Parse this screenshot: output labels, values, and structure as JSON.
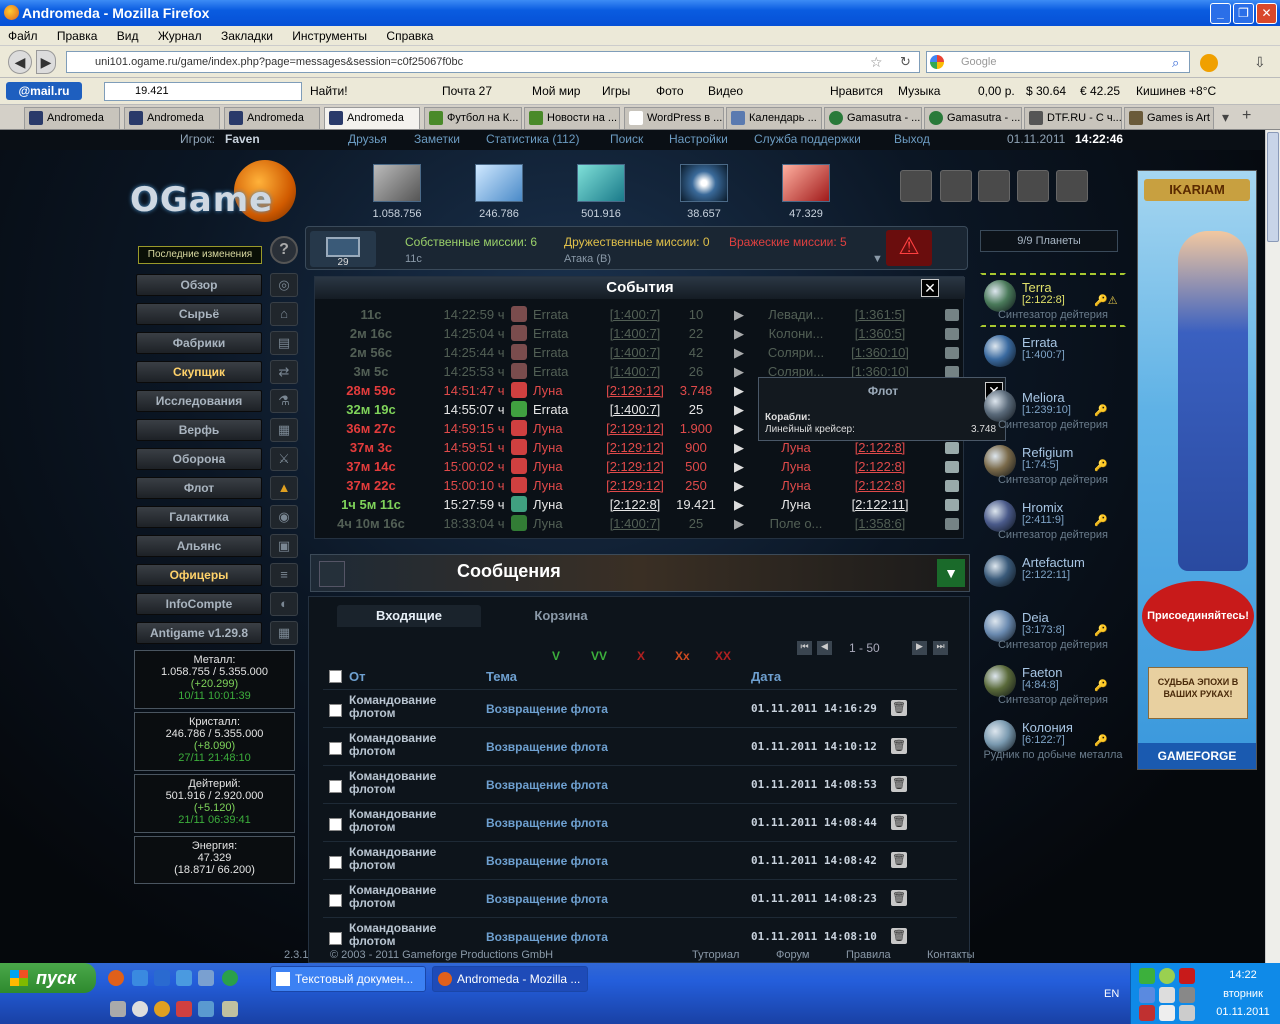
{
  "window": {
    "title": "Andromeda - Mozilla Firefox"
  },
  "menu": [
    "Файл",
    "Правка",
    "Вид",
    "Журнал",
    "Закладки",
    "Инструменты",
    "Справка"
  ],
  "nav": {
    "url": "uni101.ogame.ru/game/index.php?page=messages&session=c0f25067f0bc",
    "search_placeholder": "Google"
  },
  "mailru": {
    "logo": "@mail.ru",
    "search_value": "19.421",
    "find": "Найти!",
    "items": [
      "Почта 27",
      "Мой мир",
      "Игры",
      "Фото",
      "Видео",
      "Нравится",
      "Музыка",
      "0,00 р.",
      "$ 30.64",
      "€ 42.25",
      "Кишинев +8°C"
    ]
  },
  "tabs": [
    "Andromeda",
    "Andromeda",
    "Andromeda",
    "Andromeda",
    "Футбол на К...",
    "Новости на ...",
    "WordPress в ...",
    "Календарь ...",
    "Gamasutra - ...",
    "Gamasutra - ...",
    "DTF.RU - С ч...",
    "Games is Art ..."
  ],
  "game": {
    "topinfo": {
      "player_label": "Игрок:",
      "player": "Faven",
      "links": [
        "Друзья",
        "Заметки",
        "Статистика (112)",
        "Поиск",
        "Настройки",
        "Служба поддержки",
        "Выход"
      ],
      "datetime": "01.11.2011",
      "time": "14:22:46"
    },
    "logo": "OGame",
    "resources": [
      "1.058.756",
      "246.786",
      "501.916",
      "38.657",
      "47.329"
    ],
    "last_changes": "Последние изменения",
    "help_icon": "?",
    "menu": [
      {
        "label": "Обзор",
        "hl": false
      },
      {
        "label": "Сырьё",
        "hl": false
      },
      {
        "label": "Фабрики",
        "hl": false
      },
      {
        "label": "Скупщик",
        "hl": true
      },
      {
        "label": "Исследования",
        "hl": false
      },
      {
        "label": "Верфь",
        "hl": false
      },
      {
        "label": "Оборона",
        "hl": false
      },
      {
        "label": "Флот",
        "hl": false
      },
      {
        "label": "Галактика",
        "hl": false
      },
      {
        "label": "Альянс",
        "hl": false
      },
      {
        "label": "Офицеры",
        "hl": true
      },
      {
        "label": "InfoCompte",
        "hl": false
      },
      {
        "label": "Antigame v1.29.8",
        "hl": false
      }
    ],
    "resboxes": [
      {
        "name": "Металл:",
        "amount": "1.058.755 / 5.355.000",
        "prod": "(+20.299)",
        "date": "10/11 10:01:39"
      },
      {
        "name": "Кристалл:",
        "amount": "246.786 / 5.355.000",
        "prod": "(+8.090)",
        "date": "27/11 21:48:10"
      },
      {
        "name": "Дейтерий:",
        "amount": "501.916 / 2.920.000",
        "prod": "(+5.120)",
        "date": "21/11 06:39:41"
      },
      {
        "name": "Энергия:",
        "amount": "47.329",
        "prod": "(18.871/ 66.200)",
        "date": ""
      }
    ],
    "fleetbar": {
      "msg_count": "29",
      "own": "Собственные миссии: 6",
      "friendly": "Дружественные миссии: 0",
      "hostile": "Вражеские миссии: 5",
      "next_time": "11с",
      "next_mission": "Атака (В)"
    },
    "events": {
      "title": "События",
      "rows": [
        {
          "t": "11с",
          "at": "14:22:59 ч",
          "own": "Errata",
          "from": "[1:400:7]",
          "n": "10",
          "dest": "Левади...",
          "to": "[1:361:5]",
          "cls": "dim",
          "col": "#a06060"
        },
        {
          "t": "2м 16с",
          "at": "14:25:04 ч",
          "own": "Errata",
          "from": "[1:400:7]",
          "n": "22",
          "dest": "Колони...",
          "to": "[1:360:5]",
          "cls": "dim",
          "col": "#a06060"
        },
        {
          "t": "2м 56с",
          "at": "14:25:44 ч",
          "own": "Errata",
          "from": "[1:400:7]",
          "n": "42",
          "dest": "Соляри...",
          "to": "[1:360:10]",
          "cls": "dim",
          "col": "#a06060"
        },
        {
          "t": "3м 5с",
          "at": "14:25:53 ч",
          "own": "Errata",
          "from": "[1:400:7]",
          "n": "26",
          "dest": "Соляри...",
          "to": "[1:360:10]",
          "cls": "dim",
          "col": "#a06060"
        },
        {
          "t": "28м 59с",
          "at": "14:51:47 ч",
          "own": "Луна",
          "from": "[2:129:12]",
          "n": "3.748",
          "dest": "",
          "to": "",
          "cls": "red",
          "col": "#d04040"
        },
        {
          "t": "32м 19с",
          "at": "14:55:07 ч",
          "own": "Errata",
          "from": "[1:400:7]",
          "n": "25",
          "dest": "",
          "to": "",
          "cls": "green",
          "col": "#40a040"
        },
        {
          "t": "36м 27с",
          "at": "14:59:15 ч",
          "own": "Луна",
          "from": "[2:129:12]",
          "n": "1.900",
          "dest": "",
          "to": "",
          "cls": "red",
          "col": "#d04040"
        },
        {
          "t": "37м 3с",
          "at": "14:59:51 ч",
          "own": "Луна",
          "from": "[2:129:12]",
          "n": "900",
          "dest": "Луна",
          "to": "[2:122:8]",
          "cls": "red",
          "col": "#d04040"
        },
        {
          "t": "37м 14с",
          "at": "15:00:02 ч",
          "own": "Луна",
          "from": "[2:129:12]",
          "n": "500",
          "dest": "Луна",
          "to": "[2:122:8]",
          "cls": "red",
          "col": "#d04040"
        },
        {
          "t": "37м 22с",
          "at": "15:00:10 ч",
          "own": "Луна",
          "from": "[2:129:12]",
          "n": "250",
          "dest": "Луна",
          "to": "[2:122:8]",
          "cls": "red",
          "col": "#d04040"
        },
        {
          "t": "1ч 5м 11с",
          "at": "15:27:59 ч",
          "own": "Луна",
          "from": "[2:122:8]",
          "n": "19.421",
          "dest": "Луна",
          "to": "[2:122:11]",
          "cls": "green",
          "col": "#40a080"
        },
        {
          "t": "4ч 10м 16с",
          "at": "18:33:04 ч",
          "own": "Луна",
          "from": "[1:400:7]",
          "n": "25",
          "dest": "Поле о...",
          "to": "[1:358:6]",
          "cls": "dim",
          "col": "#40a040"
        }
      ]
    },
    "tooltip": {
      "title": "Флот",
      "ships_label": "Корабли:",
      "ship": "Линейный крейсер:",
      "count": "3.748"
    },
    "messages": {
      "title": "Сообщения",
      "tab_inbox": "Входящие",
      "tab_trash": "Корзина",
      "filters": [
        "V",
        "VV",
        "X",
        "Xx",
        "XX"
      ],
      "paging": "1 - 50",
      "cols": {
        "from": "От",
        "subject": "Тема",
        "date": "Дата"
      },
      "rows": [
        {
          "from": "Командование флотом",
          "subject": "Возвращение флота",
          "date": "01.11.2011 14:16:29"
        },
        {
          "from": "Командование флотом",
          "subject": "Возвращение флота",
          "date": "01.11.2011 14:10:12"
        },
        {
          "from": "Командование флотом",
          "subject": "Возвращение флота",
          "date": "01.11.2011 14:08:53"
        },
        {
          "from": "Командование флотом",
          "subject": "Возвращение флота",
          "date": "01.11.2011 14:08:44"
        },
        {
          "from": "Командование флотом",
          "subject": "Возвращение флота",
          "date": "01.11.2011 14:08:42"
        },
        {
          "from": "Командование флотом",
          "subject": "Возвращение флота",
          "date": "01.11.2011 14:08:23"
        },
        {
          "from": "Командование флотом",
          "subject": "Возвращение флота",
          "date": "01.11.2011 14:08:10"
        }
      ]
    },
    "planet_count": "9/9 Планеты",
    "planets": [
      {
        "name": "Terra",
        "coord": "[2:122:8]",
        "sub": "Синтезатор дейтерия",
        "key": "🔑⚠",
        "c": "#4a7a5a"
      },
      {
        "name": "Errata",
        "coord": "[1:400:7]",
        "sub": "",
        "key": "",
        "c": "#3a6aa0"
      },
      {
        "name": "Meliora",
        "coord": "[1:239:10]",
        "sub": "Синтезатор дейтерия",
        "key": "🔑",
        "c": "#5a6a7a"
      },
      {
        "name": "Refigium",
        "coord": "[1:74:5]",
        "sub": "Синтезатор дейтерия",
        "key": "🔑",
        "c": "#7a6a4a"
      },
      {
        "name": "Hromix",
        "coord": "[2:411:9]",
        "sub": "Синтезатор дейтерия",
        "key": "🔑",
        "c": "#4a5a8a"
      },
      {
        "name": "Artefactum",
        "coord": "[2:122:11]",
        "sub": "",
        "key": "",
        "c": "#3a5a7a"
      },
      {
        "name": "Deia",
        "coord": "[3:173:8]",
        "sub": "Синтезатор дейтерия",
        "key": "🔑",
        "c": "#6a8ab0"
      },
      {
        "name": "Faeton",
        "coord": "[4:84:8]",
        "sub": "Синтезатор дейтерия",
        "key": "🔑",
        "c": "#5a6a3a"
      },
      {
        "name": "Колония",
        "coord": "[6:122:7]",
        "sub": "Рудник по добыче металла",
        "key": "🔑",
        "c": "#7a9ab0"
      }
    ],
    "banner": {
      "top": "IKARIAM",
      "join": "Присоединяйтесь!",
      "slogan": "СУДЬБА ЭПОХИ В ВАШИХ РУКАХ!",
      "brand": "GAMEFORGE"
    },
    "footer": {
      "version": "2.3.1",
      "copy": "© 2003 - 2011 Gameforge Productions GmbH",
      "links": [
        "Туториал",
        "Форум",
        "Правила",
        "Контакты"
      ]
    }
  },
  "taskbar": {
    "start": "пуск",
    "tasks": [
      "Текстовый докумен...",
      "Andromeda - Mozilla ..."
    ],
    "lang": "EN",
    "time": "14:22",
    "day": "вторник",
    "date": "01.11.2011"
  }
}
